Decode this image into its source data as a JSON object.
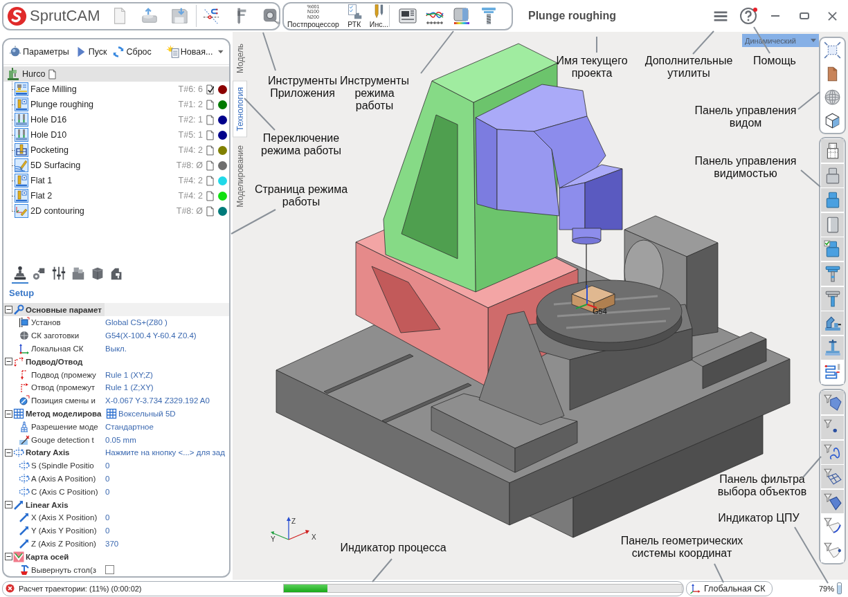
{
  "app_toolbar": {
    "logo": "SprutCAM"
  },
  "mode_toolbar": [
    {
      "kind": "postprocessor",
      "label": "Постпроцессор",
      "icon_lines": [
        "%001",
        "N100",
        "N200"
      ]
    },
    {
      "kind": "robot-cell",
      "label": "РТК"
    },
    {
      "kind": "tools",
      "label": "Инс..."
    }
  ],
  "title": "Plunge roughing",
  "help": {
    "notification": true
  },
  "operations_toolbar": [
    {
      "kind": "parameters",
      "label": "Параметры"
    },
    {
      "kind": "run",
      "label": "Пуск"
    },
    {
      "kind": "reset",
      "label": "Сброс"
    },
    {
      "kind": "new",
      "label": "Новая..."
    }
  ],
  "operations_tree": {
    "label": "Hurco",
    "selected": true,
    "calculated": false,
    "children": [
      {
        "kind": "face",
        "label": "Face Milling",
        "tool": "T#6: 6",
        "calculated": true,
        "color": "#8b0000",
        "selected": false
      },
      {
        "kind": "flat",
        "label": "Plunge roughing",
        "tool": "T#1: 2",
        "calculated": false,
        "color": "#007a00",
        "selected": false
      },
      {
        "kind": "hole",
        "label": "Hole D16",
        "tool": "T#2: 1",
        "calculated": false,
        "color": "#00008b",
        "selected": false
      },
      {
        "kind": "hole",
        "label": "Hole D10",
        "tool": "T#5: 1",
        "calculated": false,
        "color": "#00008b",
        "selected": false
      },
      {
        "kind": "pocket",
        "label": "Pocketing",
        "tool": "T#4: 2",
        "calculated": false,
        "color": "#808000",
        "selected": false
      },
      {
        "kind": "surface",
        "label": "5D Surfacing",
        "tool": "T#8: Ø",
        "calculated": false,
        "color": "#6e6e6e",
        "selected": false
      },
      {
        "kind": "flat",
        "label": "Flat 1",
        "tool": "T#4: 2",
        "calculated": false,
        "color": "#20d8e8",
        "selected": false
      },
      {
        "kind": "flat",
        "label": "Flat 2",
        "tool": "T#4: 2",
        "calculated": false,
        "color": "#10e010",
        "selected": false
      },
      {
        "kind": "contour",
        "label": "2D contouring",
        "tool": "T#8: Ø",
        "calculated": false,
        "color": "#007a7a",
        "selected": false
      }
    ]
  },
  "property_tabs": [
    {
      "selected": true
    },
    {
      "selected": false
    },
    {
      "selected": false
    },
    {
      "selected": false
    },
    {
      "selected": false
    },
    {
      "selected": false
    }
  ],
  "property_page": {
    "title": "Setup"
  },
  "properties": [
    {
      "kind": "main",
      "name": "Основные парамет",
      "selected": true,
      "expanded": true,
      "rows": [
        {
          "kind": "setup",
          "name": "Установ",
          "value": "Global CS+(Z80 )"
        },
        {
          "kind": "blank-cs",
          "name": "СК заготовки",
          "value": "G54(X-100.4 Y-60.4 Z0.4)"
        },
        {
          "kind": "local-cs",
          "name": "Локальная СК",
          "value": "Выкл."
        }
      ]
    },
    {
      "kind": "approach-retract",
      "name": "Подвод/Отвод",
      "selected": false,
      "expanded": true,
      "rows": [
        {
          "kind": "approach",
          "name": "Подвод (промежу",
          "value": "Rule 1 (XY;Z)"
        },
        {
          "kind": "retract",
          "name": "Отвод (промежут",
          "value": "Rule 1 (Z;XY)"
        },
        {
          "kind": "tool-change",
          "name": "Позиция смены и",
          "value": "X-0.067 Y-3.734 Z329.192 A0"
        }
      ]
    },
    {
      "kind": "modeling",
      "name": "Метод моделирова",
      "value": "Воксельный 5D",
      "selected": false,
      "expanded": true,
      "rows": [
        {
          "kind": "resolution",
          "name": "Разрешение моде",
          "value": "Стандартное"
        },
        {
          "kind": "gouge",
          "name": "Gouge detection t",
          "value": "0.05 mm"
        }
      ]
    },
    {
      "kind": "rotary",
      "name": "Rotary Axis",
      "value": "Нажмите на кнопку <...> для зад",
      "selected": false,
      "expanded": true,
      "rows": [
        {
          "kind": "rotary",
          "name": "S (Spindle Positio",
          "value": "0"
        },
        {
          "kind": "rotary",
          "name": "A (Axis A Position)",
          "value": "0"
        },
        {
          "kind": "rotary",
          "name": "C (Axis C Position)",
          "value": "0"
        }
      ]
    },
    {
      "kind": "linear",
      "name": "Linear Axis",
      "selected": false,
      "expanded": true,
      "rows": [
        {
          "kind": "linear",
          "name": "X (Axis X Position)",
          "value": "0"
        },
        {
          "kind": "linear",
          "name": "Y (Axis Y Position)",
          "value": "0"
        },
        {
          "kind": "linear",
          "name": "Z (Axis Z Position)",
          "value": "370"
        }
      ]
    },
    {
      "kind": "axis-map",
      "name": "Карта осей",
      "selected": false,
      "expanded": true,
      "rows": [
        {
          "kind": "flip",
          "name": "Вывернуть стол(з",
          "checked": false
        }
      ]
    }
  ],
  "mode_tabs": [
    {
      "label": "Модель",
      "selected": false
    },
    {
      "label": "Технология",
      "selected": true
    },
    {
      "label": "Моделирование",
      "selected": false
    }
  ],
  "viewport": {
    "view_mode": "Динамический",
    "origin_label": "G54",
    "axes": [
      "X",
      "Y",
      "Z"
    ]
  },
  "visibility_panel": [
    {
      "on": true
    },
    {
      "on": true
    },
    {
      "on": true
    },
    {
      "on": true
    },
    {
      "on": true
    },
    {
      "on": true
    },
    {
      "on": true
    },
    {
      "on": true
    },
    {
      "on": true
    },
    {
      "on": false
    }
  ],
  "filter_panel": [
    {
      "on": true
    },
    {
      "on": true
    },
    {
      "on": true
    },
    {
      "on": true
    },
    {
      "on": true
    },
    {
      "on": false
    },
    {
      "on": false
    }
  ],
  "annotations": [
    {
      "lines": [
        "Имя текущего",
        "проекта"
      ]
    },
    {
      "lines": [
        "Дополнительные",
        "утилиты"
      ]
    },
    {
      "lines": [
        "Помощь"
      ]
    },
    {
      "lines": [
        "Инструменты",
        "Приложения"
      ]
    },
    {
      "lines": [
        "Инструменты",
        "режима",
        "работы"
      ]
    },
    {
      "lines": [
        "Панель управления",
        "видом"
      ]
    },
    {
      "lines": [
        "Переключение",
        "режима работы"
      ]
    },
    {
      "lines": [
        "Панель управления",
        "видимостью"
      ]
    },
    {
      "lines": [
        "Страница режима",
        "работы"
      ]
    },
    {
      "lines": [
        "Панель фильтра",
        "выбора объектов"
      ]
    },
    {
      "lines": [
        "Индикатор ЦПУ"
      ]
    },
    {
      "lines": [
        "Индикатор процесса"
      ]
    },
    {
      "lines": [
        "Панель геометрических",
        "системы координат"
      ]
    }
  ],
  "status_bar": {
    "error": true,
    "message": "Расчет траектории: (11%) (0:00:02)",
    "progress": {
      "level": 0.11
    },
    "coordinate_system": "Глобальная СК",
    "cpu": {
      "reading": "79%",
      "level": 0.79
    }
  }
}
